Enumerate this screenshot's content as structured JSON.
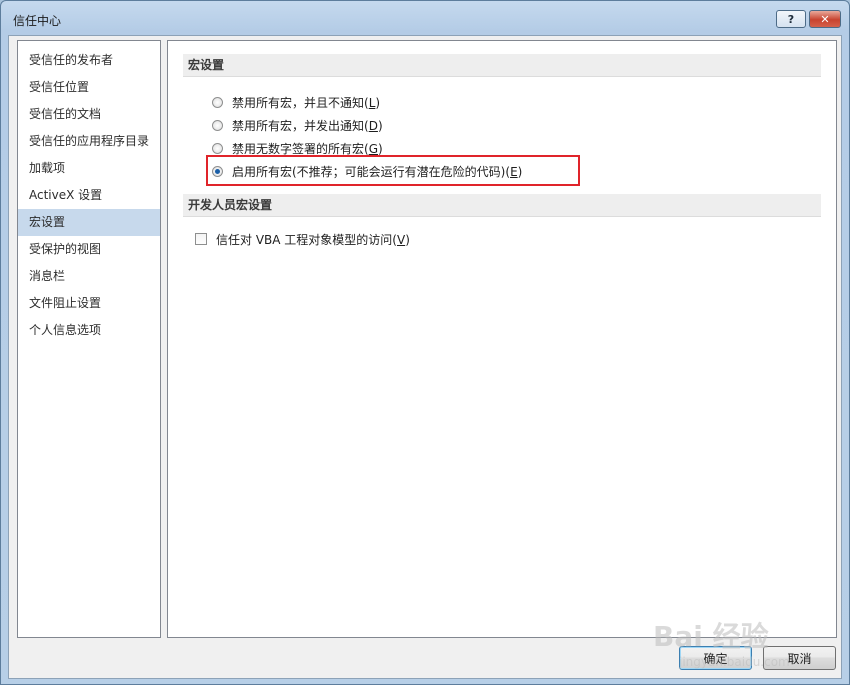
{
  "window": {
    "title": "信任中心",
    "help_label": "?",
    "close_label": "✕"
  },
  "sidebar": {
    "items": [
      {
        "label": "受信任的发布者",
        "selected": false
      },
      {
        "label": "受信任位置",
        "selected": false
      },
      {
        "label": "受信任的文档",
        "selected": false
      },
      {
        "label": "受信任的应用程序目录",
        "selected": false
      },
      {
        "label": "加载项",
        "selected": false
      },
      {
        "label": "ActiveX 设置",
        "selected": false
      },
      {
        "label": "宏设置",
        "selected": true
      },
      {
        "label": "受保护的视图",
        "selected": false
      },
      {
        "label": "消息栏",
        "selected": false
      },
      {
        "label": "文件阻止设置",
        "selected": false
      },
      {
        "label": "个人信息选项",
        "selected": false
      }
    ]
  },
  "macro_settings": {
    "header": "宏设置",
    "options": [
      {
        "text": "禁用所有宏，并且不通知(",
        "key": "L",
        "close": ")",
        "checked": false
      },
      {
        "text": "禁用所有宏，并发出通知(",
        "key": "D",
        "close": ")",
        "checked": false
      },
      {
        "text": "禁用无数字签署的所有宏(",
        "key": "G",
        "close": ")",
        "checked": false
      },
      {
        "text": "启用所有宏(不推荐；可能会运行有潜在危险的代码)(",
        "key": "E",
        "close": ")",
        "checked": true
      }
    ]
  },
  "developer_settings": {
    "header": "开发人员宏设置",
    "checkbox": {
      "text": "信任对 VBA 工程对象模型的访问(",
      "key": "V",
      "close": ")",
      "checked": false
    }
  },
  "buttons": {
    "ok": "确定",
    "cancel": "取消"
  },
  "watermark": {
    "text": "Bai 经验",
    "sub": "jingyan.baidu.com"
  },
  "colors": {
    "highlight_box": "#e0242a",
    "selected_nav": "#c7d9ec",
    "radio_dot": "#1b5fa8"
  }
}
